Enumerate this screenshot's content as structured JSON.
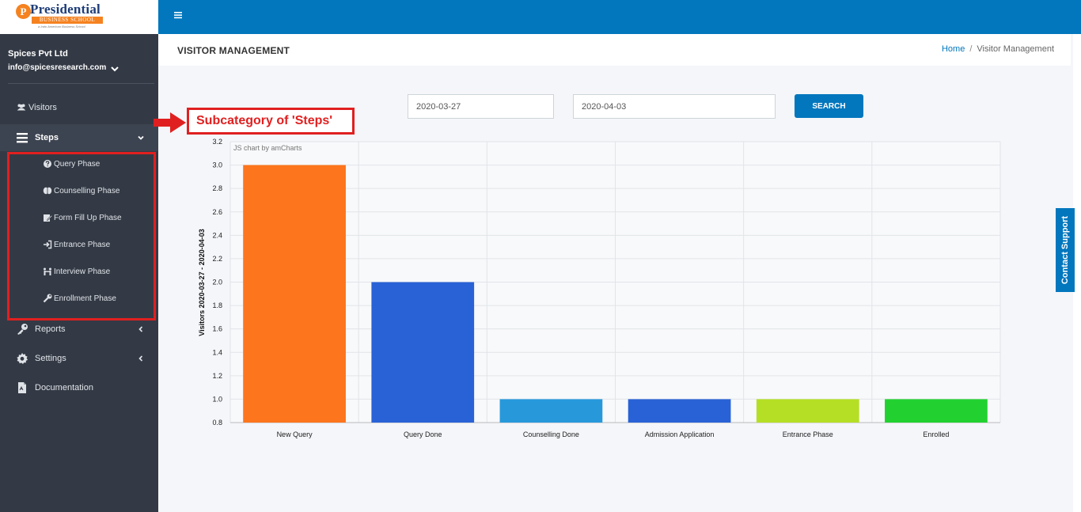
{
  "logo": {
    "title": "Presidential",
    "subtitle": "BUSINESS SCHOOL",
    "tagline": "a Indo American Business School",
    "letter": "P"
  },
  "user": {
    "company": "Spices Pvt Ltd",
    "email": "info@spicesresearch.com"
  },
  "sidebar": {
    "items": [
      {
        "label": "Visitors",
        "icon": "users-icon"
      },
      {
        "label": "Steps",
        "icon": "bars-icon"
      },
      {
        "label": "Reports",
        "icon": "key-icon"
      },
      {
        "label": "Settings",
        "icon": "gear-icon"
      },
      {
        "label": "Documentation",
        "icon": "file-icon"
      }
    ],
    "sub_items": [
      {
        "label": "Query Phase",
        "icon": "question-circle-icon"
      },
      {
        "label": "Counselling Phase",
        "icon": "brain-icon"
      },
      {
        "label": "Form Fill Up Phase",
        "icon": "edit-icon"
      },
      {
        "label": "Entrance Phase",
        "icon": "sign-in-icon"
      },
      {
        "label": "Interview Phase",
        "icon": "people-table-icon"
      },
      {
        "label": "Enrollment Phase",
        "icon": "wrench-icon"
      }
    ]
  },
  "header": {
    "title": "VISITOR MANAGEMENT",
    "breadcrumb": {
      "home": "Home",
      "separator": "/",
      "current": "Visitor Management"
    }
  },
  "filters": {
    "start_date": "2020-03-27",
    "end_date": "2020-04-03",
    "search_label": "SEARCH"
  },
  "annotation": {
    "text": "Subcategory of 'Steps'"
  },
  "contact_support": "Contact Support",
  "colors": {
    "topbar": "#0277bd",
    "sidebar": "#343a45",
    "annotation": "#e02020"
  },
  "chart_data": {
    "type": "bar",
    "credit": "JS chart by amCharts",
    "categories": [
      "New Query",
      "Query Done",
      "Counselling Done",
      "Admission Application",
      "Entrance Phase",
      "Enrolled"
    ],
    "values": [
      3,
      2,
      1,
      1,
      1,
      1
    ],
    "colors": [
      "#fd751c",
      "#2962d6",
      "#2799db",
      "#2962d6",
      "#b5df25",
      "#22d130"
    ],
    "ylabel": "Visitors 2020-03-27 - 2020-04-03",
    "xlabel": "",
    "ylim": [
      0.8,
      3.2
    ],
    "yticks": [
      "0.8",
      "1.0",
      "1.2",
      "1.4",
      "1.6",
      "1.8",
      "2.0",
      "2.2",
      "2.4",
      "2.6",
      "2.8",
      "3.0",
      "3.2"
    ],
    "grid": true
  }
}
